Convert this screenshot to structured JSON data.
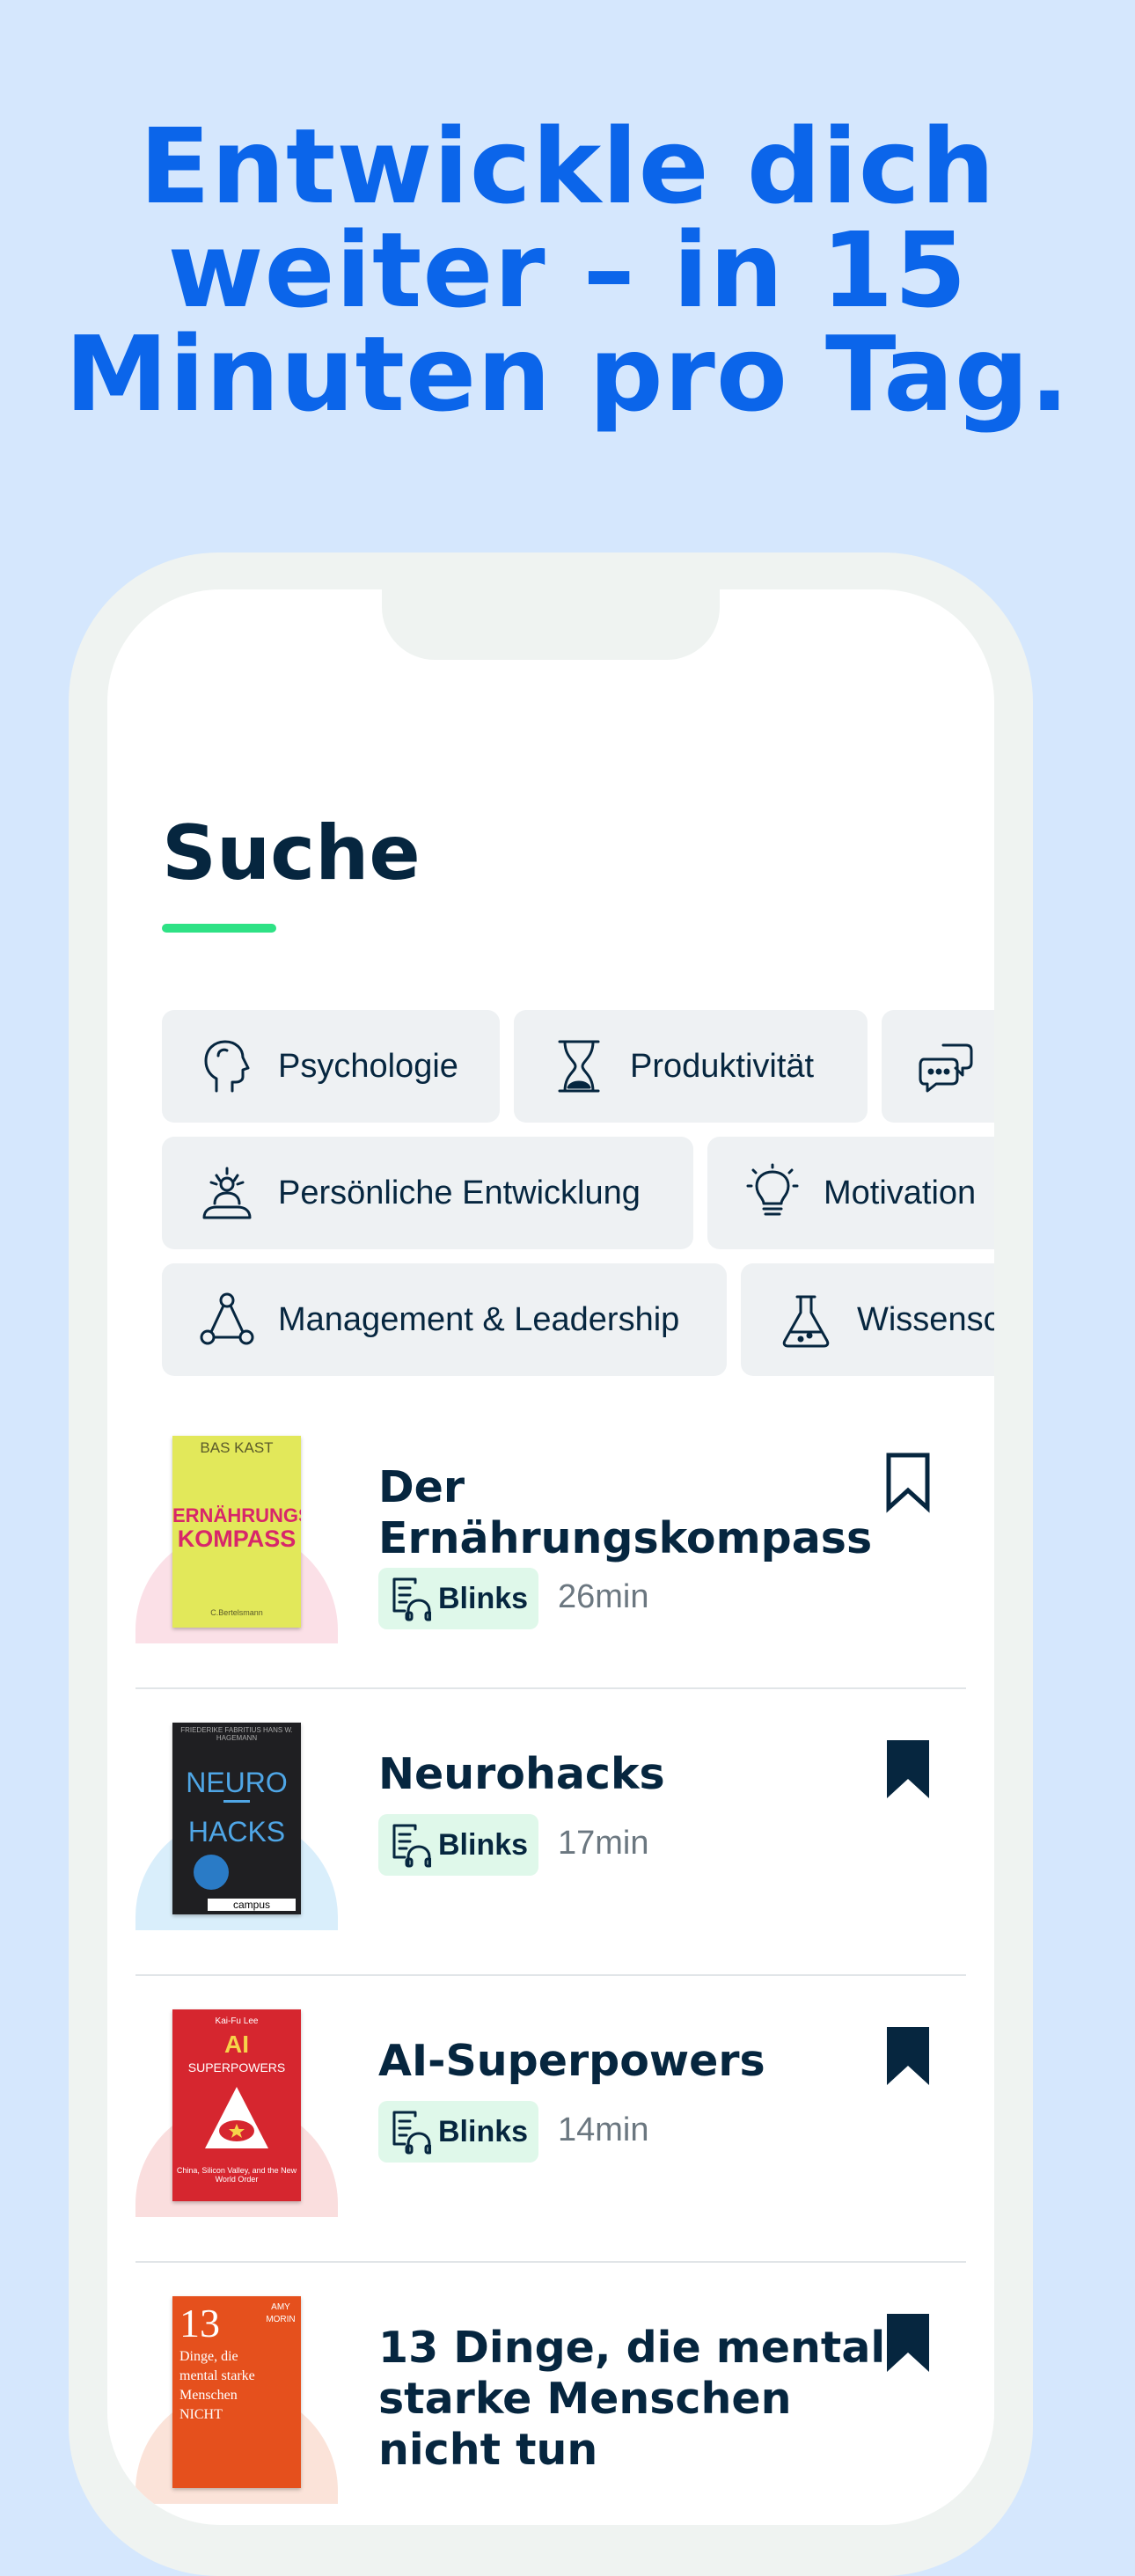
{
  "headline": {
    "line1": "Entwickle dich",
    "line2": "weiter – in 15",
    "line3": "Minuten pro Tag."
  },
  "screen": {
    "title": "Suche"
  },
  "categories": [
    {
      "label": "Psychologie",
      "icon": "head-profile-icon"
    },
    {
      "label": "Produktivität",
      "icon": "hourglass-icon"
    },
    {
      "label": "",
      "icon": "speech-bubbles-icon"
    },
    {
      "label": "Persönliche Entwicklung",
      "icon": "meditation-person-icon"
    },
    {
      "label": "Motivation",
      "icon": "lightbulb-icon"
    },
    {
      "label": "Management & Leadership",
      "icon": "network-nodes-icon"
    },
    {
      "label": "Wissensc",
      "icon": "flask-icon"
    }
  ],
  "books": [
    {
      "title": "Der Ernährungskompass",
      "badge": "Blinks",
      "duration": "26min",
      "bookmarked": false,
      "cover": {
        "author": "BAS KAST",
        "title_line1": "ERNÄHRUNGS",
        "title_line2": "KOMPASS",
        "publisher": "C.Bertelsmann"
      }
    },
    {
      "title": "Neurohacks",
      "badge": "Blinks",
      "duration": "17min",
      "bookmarked": true,
      "cover": {
        "author": "FRIEDERIKE FABRITIUS HANS W. HAGEMANN",
        "title_line1": "NEURO",
        "title_line2": "HACKS",
        "publisher": "campus"
      }
    },
    {
      "title": "AI-Superpowers",
      "badge": "Blinks",
      "duration": "14min",
      "bookmarked": true,
      "cover": {
        "author": "Kai-Fu Lee",
        "title_line1": "AI",
        "title_line2": "SUPERPOWERS",
        "publisher": "China, Silicon Valley, and the New World Order"
      }
    },
    {
      "title": "13 Dinge, die mental starke Menschen nicht tun",
      "badge": "",
      "duration": "",
      "bookmarked": true,
      "cover": {
        "author": "AMY MORIN",
        "title_line1": "13",
        "title_line2": "Dinge, die mental starke Menschen NICHT",
        "publisher": ""
      }
    }
  ],
  "colors": {
    "background": "#d5e7fd",
    "headline": "#0b65ea",
    "text": "#06263f",
    "accent": "#2ee285",
    "badge_bg": "#dff8ea"
  }
}
